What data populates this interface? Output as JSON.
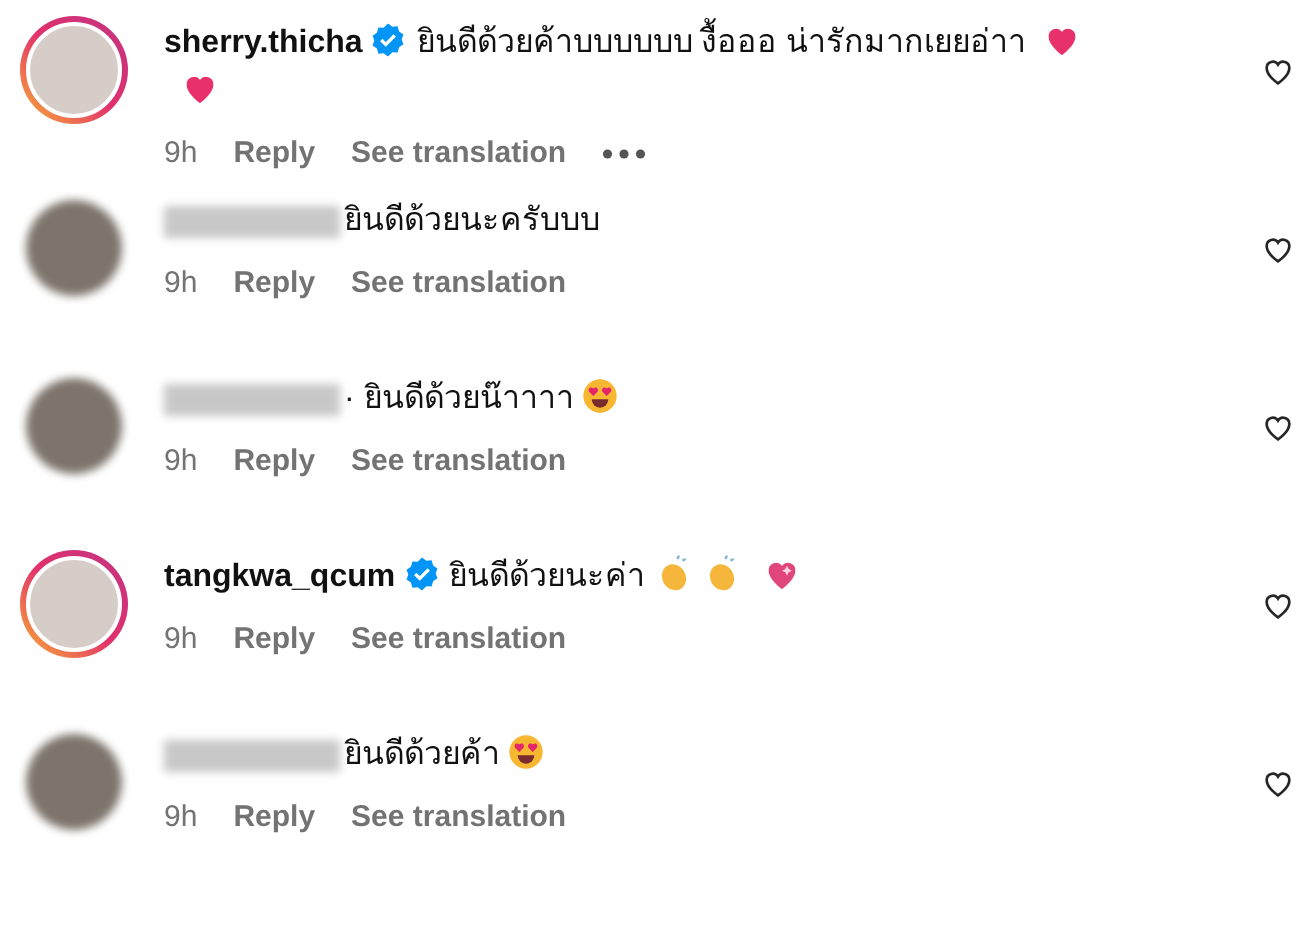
{
  "comments": [
    {
      "username": "sherry.thicha",
      "verified": true,
      "story_ring": true,
      "text": "ยินดีด้วยค้าบบบบบบ งื้อออ น่ารักมากเยยอ่าา",
      "emojis": [
        {
          "kind": "heart"
        },
        {
          "kind": "heart"
        }
      ],
      "time": "9h",
      "reply": "Reply",
      "translate": "See translation",
      "more": true
    },
    {
      "verified": false,
      "story_ring": false,
      "text": "ยินดีด้วยนะครับบบ",
      "time": "9h",
      "reply": "Reply",
      "translate": "See translation",
      "more": false
    },
    {
      "verified": false,
      "story_ring": false,
      "text": "· ยินดีด้วยน๊าาาา",
      "emojis": [
        {
          "kind": "heart-eyes"
        }
      ],
      "time": "9h",
      "reply": "Reply",
      "translate": "See translation",
      "more": false
    },
    {
      "username": "tangkwa_qcum",
      "verified": true,
      "story_ring": true,
      "text": "ยินดีด้วยนะค่า",
      "emojis": [
        {
          "kind": "clap"
        },
        {
          "kind": "clap"
        },
        {
          "kind": "sparkle-heart"
        }
      ],
      "time": "9h",
      "reply": "Reply",
      "translate": "See translation",
      "more": false
    },
    {
      "verified": false,
      "story_ring": false,
      "text": "ยินดีด้วยค้า",
      "emojis": [
        {
          "kind": "heart-eyes"
        }
      ],
      "time": "9h",
      "reply": "Reply",
      "translate": "See translation",
      "more": false
    }
  ]
}
